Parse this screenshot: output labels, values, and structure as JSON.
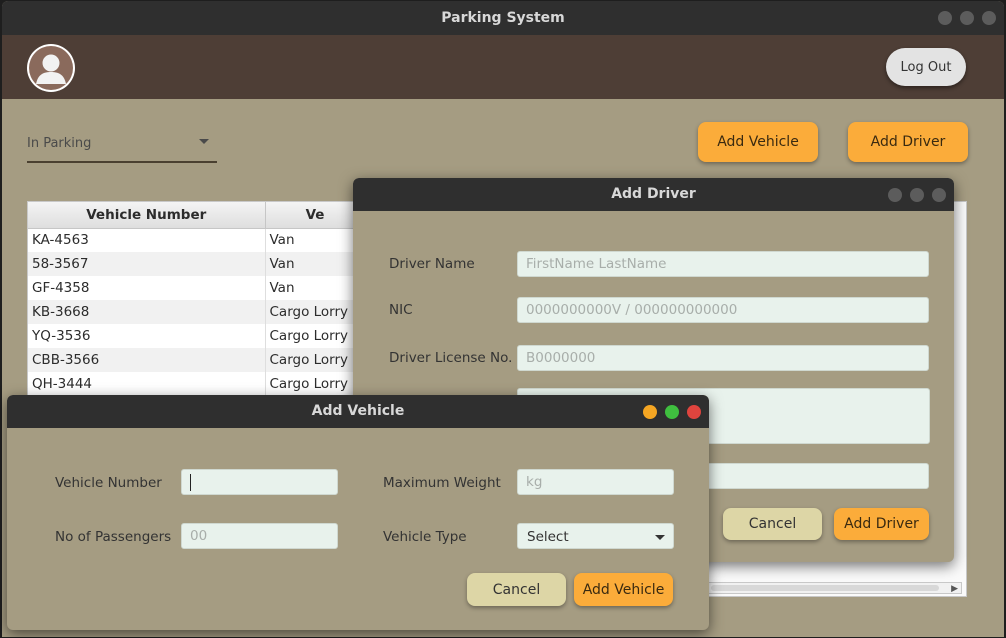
{
  "main_window": {
    "title": "Parking System",
    "logout_label": "Log Out",
    "filter": {
      "selected": "In Parking"
    },
    "add_vehicle_label": "Add Vehicle",
    "add_driver_label": "Add Driver"
  },
  "table": {
    "columns": [
      "Vehicle Number",
      "Ve"
    ],
    "rows": [
      [
        "KA-4563",
        "Van"
      ],
      [
        "58-3567",
        "Van"
      ],
      [
        "GF-4358",
        "Van"
      ],
      [
        "KB-3668",
        "Cargo Lorry"
      ],
      [
        "YQ-3536",
        "Cargo Lorry"
      ],
      [
        "CBB-3566",
        "Cargo Lorry"
      ],
      [
        "QH-3444",
        "Cargo Lorry"
      ]
    ]
  },
  "add_driver_dialog": {
    "title": "Add Driver",
    "fields": {
      "driver_name": {
        "label": "Driver Name",
        "placeholder": "FirstName LastName"
      },
      "nic": {
        "label": "NIC",
        "placeholder": "0000000000V / 000000000000"
      },
      "license": {
        "label": "Driver License No.",
        "placeholder": "B0000000"
      }
    },
    "cancel_label": "Cancel",
    "submit_label": "Add Driver"
  },
  "add_vehicle_dialog": {
    "title": "Add Vehicle",
    "fields": {
      "vehicle_number": {
        "label": "Vehicle Number",
        "value": ""
      },
      "max_weight": {
        "label": "Maximum Weight",
        "placeholder": "kg"
      },
      "passengers": {
        "label": "No of Passengers",
        "placeholder": "00"
      },
      "vehicle_type": {
        "label": "Vehicle Type",
        "selected": "Select"
      }
    },
    "cancel_label": "Cancel",
    "submit_label": "Add Vehicle"
  },
  "colors": {
    "accent_orange": "#fbac3a",
    "window_bg": "#a59c82",
    "header_bg": "#4e3e36",
    "traffic_yellow": "#f5a623",
    "traffic_green": "#3fbf3f",
    "traffic_red": "#e0443e"
  }
}
